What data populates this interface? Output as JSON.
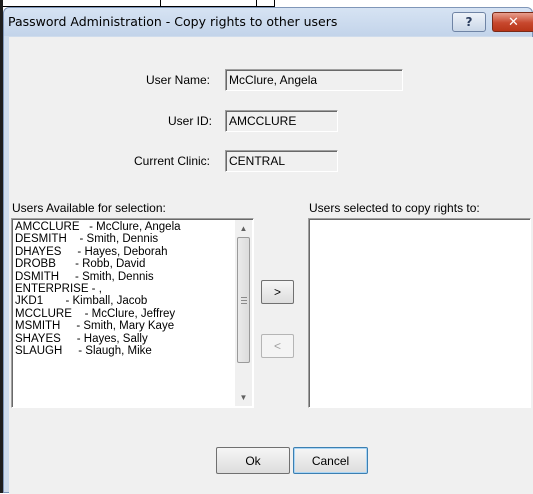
{
  "window": {
    "title": "Password Administration - Copy rights to other users",
    "help_glyph": "?",
    "close_glyph": "✕"
  },
  "user_info": {
    "user_name_label": "User Name:",
    "user_name_value": "McClure, Angela",
    "user_id_label": "User ID:",
    "user_id_value": "AMCCLURE",
    "current_clinic_label": "Current Clinic:",
    "current_clinic_value": "CENTRAL"
  },
  "available": {
    "label": "Users Available for selection:",
    "items": [
      "AMCCLURE   - McClure, Angela",
      "DESMITH    - Smith, Dennis",
      "DHAYES     - Hayes, Deborah",
      "DROBB      - Robb, David",
      "DSMITH     - Smith, Dennis",
      "ENTERPRISE - ,",
      "JKD1       - Kimball, Jacob",
      "MCCLURE    - McClure, Jeffrey",
      "MSMITH     - Smith, Mary Kaye",
      "SHAYES     - Hayes, Sally",
      "SLAUGH     - Slaugh, Mike"
    ]
  },
  "selected": {
    "label": "Users selected to copy rights to:",
    "items": []
  },
  "buttons": {
    "add": ">",
    "remove": "<",
    "ok": "Ok",
    "cancel": "Cancel"
  }
}
